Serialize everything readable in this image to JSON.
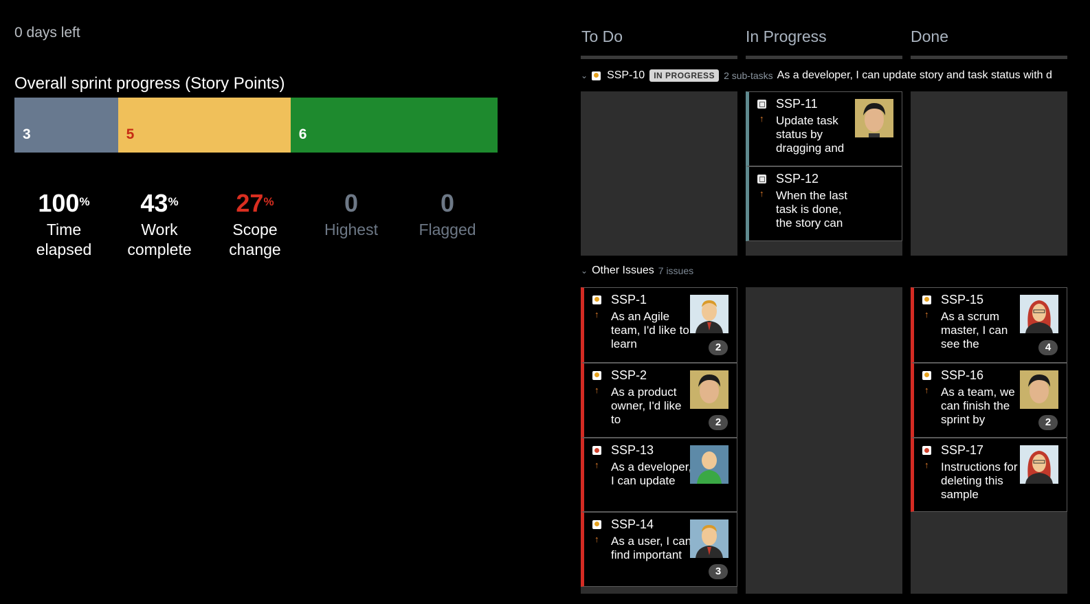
{
  "sprint": {
    "days_left": "0 days left",
    "progress_title": "Overall sprint progress (Story Points)",
    "segments": [
      {
        "label": "3",
        "value": 3,
        "color": "#68798f"
      },
      {
        "label": "5",
        "value": 5,
        "color": "#f0c05a"
      },
      {
        "label": "6",
        "value": 6,
        "color": "#1e8a2e"
      }
    ],
    "stats": [
      {
        "value": "100",
        "unit": "%",
        "label_line1": "Time",
        "label_line2": "elapsed"
      },
      {
        "value": "43",
        "unit": "%",
        "label_line1": "Work",
        "label_line2": "complete"
      },
      {
        "value": "27",
        "unit": "%",
        "label_line1": "Scope",
        "label_line2": "change"
      },
      {
        "value": "0",
        "label_line1": "Highest"
      },
      {
        "value": "0",
        "label_line1": "Flagged"
      }
    ]
  },
  "board": {
    "columns": [
      "To Do",
      "In Progress",
      "Done"
    ],
    "swimlane": {
      "key": "SSP-10",
      "status": "IN PROGRESS",
      "subtasks": "2 sub-tasks",
      "summary": "As a developer, I can update story and task status with d"
    },
    "other": {
      "title": "Other Issues",
      "count": "7 issues"
    },
    "cards": {
      "ssp11": {
        "key": "SSP-11",
        "summary": "Update task status by dragging and"
      },
      "ssp12": {
        "key": "SSP-12",
        "summary": "When the last task is done, the story can"
      },
      "ssp1": {
        "key": "SSP-1",
        "summary": "As an Agile team, I'd like to learn",
        "badge": "2"
      },
      "ssp2": {
        "key": "SSP-2",
        "summary": "As a product owner, I'd like to",
        "badge": "2"
      },
      "ssp13": {
        "key": "SSP-13",
        "summary": "As a developer, I can update"
      },
      "ssp14": {
        "key": "SSP-14",
        "summary": "As a user, I can find important",
        "badge": "3"
      },
      "ssp15": {
        "key": "SSP-15",
        "summary": "As a scrum master, I can see the",
        "badge": "4"
      },
      "ssp16": {
        "key": "SSP-16",
        "summary": "As a team, we can finish the sprint by",
        "badge": "2"
      },
      "ssp17": {
        "key": "SSP-17",
        "summary": "Instructions for deleting this sample"
      }
    }
  },
  "colors": {
    "flag": "#d42b23",
    "in_progress_lane": "#5f8a8f",
    "column_bg": "#2e2e2e"
  }
}
